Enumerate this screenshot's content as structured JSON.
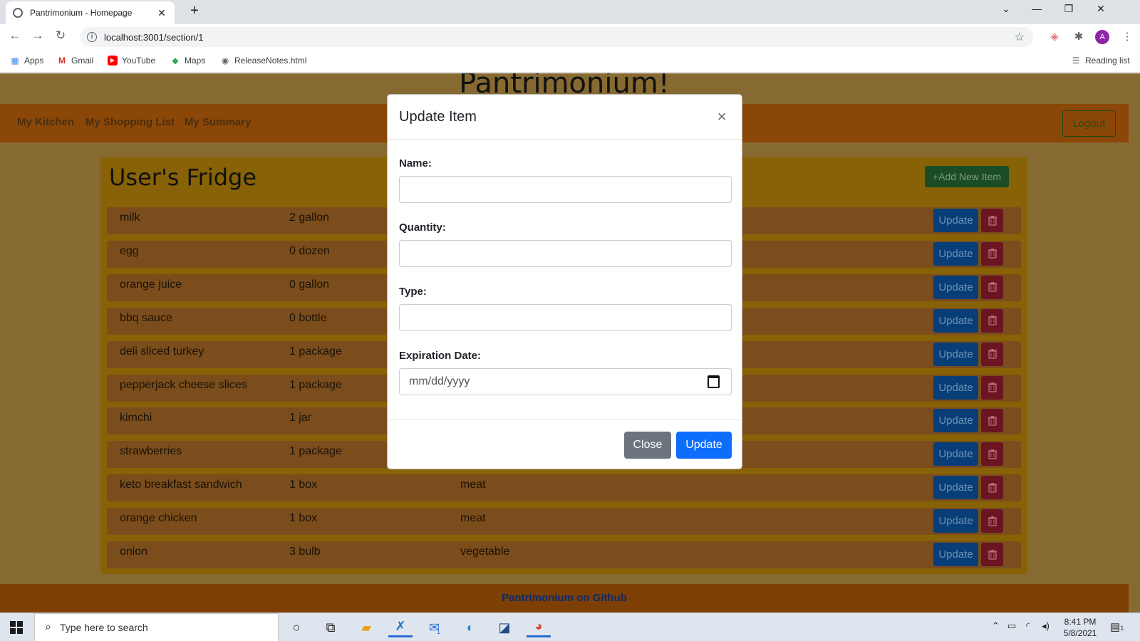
{
  "browser": {
    "tab_title": "Pantrimonium - Homepage",
    "tab_close": "✕",
    "new_tab": "+",
    "url": "localhost:3001/section/1",
    "bookmarks": [
      {
        "label": "Apps",
        "icon": "apps-grid-icon"
      },
      {
        "label": "Gmail",
        "icon": "gmail-icon"
      },
      {
        "label": "YouTube",
        "icon": "youtube-icon"
      },
      {
        "label": "Maps",
        "icon": "maps-icon"
      },
      {
        "label": "ReleaseNotes.html",
        "icon": "globe-icon"
      }
    ],
    "reading_list": "Reading list",
    "profile_initial": "A"
  },
  "app": {
    "brand": "Pantrimonium!",
    "nav": [
      "My Kitchen",
      "My Shopping List",
      "My Summary"
    ],
    "logout_label": "Logout",
    "fridge_title": "User's Fridge",
    "add_item_label": "+Add New Item",
    "update_label": "Update",
    "items": [
      {
        "name": "milk",
        "qty": "2 gallon",
        "type": ""
      },
      {
        "name": "egg",
        "qty": "0 dozen",
        "type": ""
      },
      {
        "name": "orange juice",
        "qty": "0 gallon",
        "type": ""
      },
      {
        "name": "bbq sauce",
        "qty": "0 bottle",
        "type": ""
      },
      {
        "name": "deli sliced turkey",
        "qty": "1 package",
        "type": ""
      },
      {
        "name": "pepperjack cheese slices",
        "qty": "1 package",
        "type": ""
      },
      {
        "name": "kimchi",
        "qty": "1 jar",
        "type": ""
      },
      {
        "name": "strawberries",
        "qty": "1 package",
        "type": ""
      },
      {
        "name": "keto breakfast sandwich",
        "qty": "1 box",
        "type": "meat"
      },
      {
        "name": "orange chicken",
        "qty": "1 box",
        "type": "meat"
      },
      {
        "name": "onion",
        "qty": "3 bulb",
        "type": "vegetable"
      }
    ],
    "footer_link": "Pantrimonium on Github"
  },
  "modal": {
    "title": "Update Item",
    "close_x": "×",
    "name_label": "Name:",
    "name_value": "",
    "quantity_label": "Quantity:",
    "quantity_value": "",
    "type_label": "Type:",
    "type_value": "",
    "expiration_label": "Expiration Date:",
    "expiration_placeholder": "mm/dd/yyyy",
    "close_button": "Close",
    "update_button": "Update"
  },
  "taskbar": {
    "search_placeholder": "Type here to search",
    "time": "8:41 PM",
    "date": "5/8/2021",
    "mail_badge": "1",
    "notification_badge": "1"
  },
  "colors": {
    "page_bg": "#866a32",
    "navbar": "#8a4708",
    "fridge_panel": "#876207",
    "row": "#7b4d1c",
    "primary": "#0d6efd",
    "secondary": "#6c757d"
  }
}
